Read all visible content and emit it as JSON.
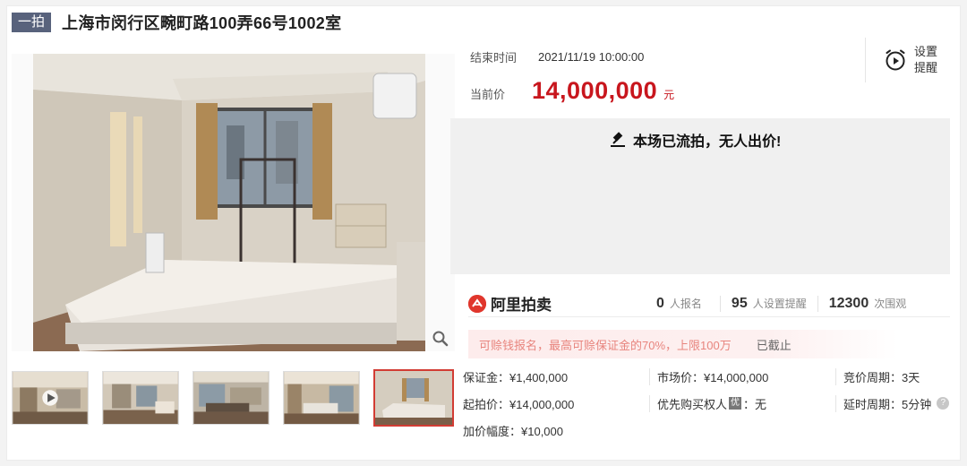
{
  "header": {
    "round_badge": "一拍",
    "title": "上海市闵行区畹町路100弄66号1002室"
  },
  "gallery": {
    "zoom_icon": "magnifier-icon",
    "thumbnails": [
      {
        "kind": "video",
        "active": false
      },
      {
        "kind": "photo",
        "active": false
      },
      {
        "kind": "photo",
        "active": false
      },
      {
        "kind": "photo",
        "active": false
      },
      {
        "kind": "photo",
        "active": true
      }
    ]
  },
  "auction": {
    "end_label": "结束时间",
    "end_value": "2021/11/19 10:00:00",
    "price_label": "当前价",
    "price_value": "14,000,000",
    "price_unit": "元",
    "remind_line1": "设置",
    "remind_line2": "提醒",
    "status_text": "本场已流拍，无人出价!"
  },
  "stats": {
    "brand": "阿里拍卖",
    "signups_count": "0",
    "signups_label": "人报名",
    "reminders_count": "95",
    "reminders_label": "人设置提醒",
    "views_count": "12300",
    "views_label": "次围观"
  },
  "notice": {
    "message": "可赊钱报名，最高可赊保证金的70%，上限100万",
    "cutoff": "已截止"
  },
  "details": {
    "deposit": "保证金：¥1,400,000",
    "market_price": "市场价：¥14,000,000",
    "bid_period": "竞价周期：3天",
    "start_price": "起拍价：¥14,000,000",
    "priority_prefix": "优先购买权人",
    "priority_badge": "优",
    "priority_value": "：无",
    "extend_period": "延时周期：5分钟",
    "increment": "加价幅度：¥10,000"
  },
  "colors": {
    "price_red": "#c8161d",
    "badge_slate": "#58627c",
    "active_thumb_border": "#d23c34"
  }
}
